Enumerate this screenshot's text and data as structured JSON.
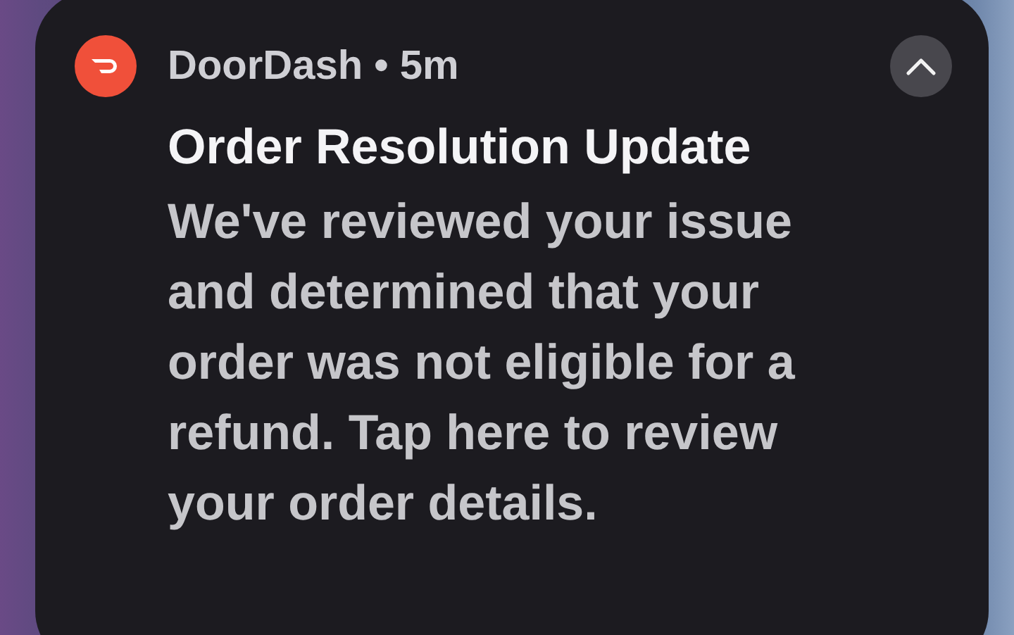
{
  "notification": {
    "app_name": "DoorDash • 5m",
    "title": "Order Resolution Update",
    "body": "We've reviewed your issue and determined that your order was not eligible for a refund. Tap here to review your order details.",
    "expanded": true
  }
}
